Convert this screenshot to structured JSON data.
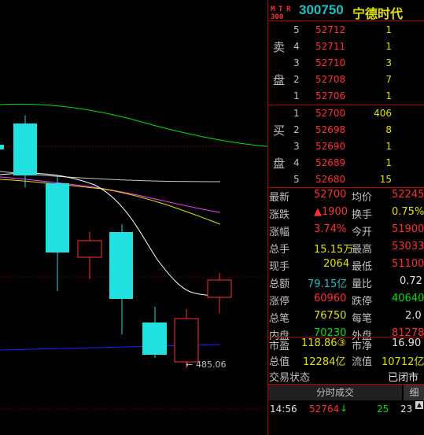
{
  "chart": {
    "low_annotation": "485.06",
    "colors": {
      "up": "#ff3030",
      "down": "#20e0e0",
      "ma5": "#ffffff",
      "ma10": "#e0e000",
      "ma20": "#ff40ff",
      "ma60": "#00e000",
      "bg": "#000000",
      "grid": "#7a0000",
      "blue": "#2020ff"
    }
  },
  "header": {
    "badge": [
      "M",
      "T",
      "R",
      "300"
    ],
    "code": "300750",
    "name": "宁德时代"
  },
  "orderbook": {
    "sell_label_1": "卖",
    "sell_label_2": "盘",
    "buy_label_1": "买",
    "buy_label_2": "盘",
    "sell": [
      {
        "level": "5",
        "price": "52712",
        "vol": "1"
      },
      {
        "level": "4",
        "price": "52711",
        "vol": "1"
      },
      {
        "level": "3",
        "price": "52710",
        "vol": "3"
      },
      {
        "level": "2",
        "price": "52708",
        "vol": "7"
      },
      {
        "level": "1",
        "price": "52706",
        "vol": "1"
      }
    ],
    "buy": [
      {
        "level": "1",
        "price": "52700",
        "vol": "406"
      },
      {
        "level": "2",
        "price": "52698",
        "vol": "8"
      },
      {
        "level": "3",
        "price": "52690",
        "vol": "1"
      },
      {
        "level": "4",
        "price": "52689",
        "vol": "1"
      },
      {
        "level": "5",
        "price": "52680",
        "vol": "15"
      }
    ]
  },
  "quote": {
    "latest_label": "最新",
    "latest": "52700",
    "avg_label": "均价",
    "avg": "52245",
    "change_label": "涨跌",
    "change": "▲1900",
    "turnover_label": "换手",
    "turnover": "0.75%",
    "pct_label": "涨幅",
    "pct": "3.74%",
    "open_label": "今开",
    "open": "51900",
    "vol_label": "总手",
    "vol": "15.15万",
    "high_label": "最高",
    "high": "53033",
    "cur_label": "现手",
    "cur": "2064",
    "low_label": "最低",
    "low": "51100",
    "amount_label": "总额",
    "amount": "79.15亿",
    "ratio_label": "量比",
    "ratio": "0.72",
    "limitup_label": "涨停",
    "limitup": "60960",
    "limitdown_label": "跌停",
    "limitdown": "40640",
    "trades_label": "总笔",
    "trades": "76750",
    "pertrade_label": "每笔",
    "pertrade": "2.0",
    "inner_label": "内盘",
    "inner": "70230",
    "outer_label": "外盘",
    "outer": "81278",
    "pe_label": "市盈",
    "pe": "118.86③",
    "pb_label": "市净",
    "pb": "16.90",
    "mktcap_label": "总值",
    "mktcap": "12284亿",
    "float_label": "流值",
    "float": "10712亿",
    "status_label": "交易状态",
    "status": "已闭市"
  },
  "ticks_panel": {
    "tab1": "分时成交",
    "tab2": "细",
    "rows": [
      {
        "time": "14:56",
        "price": "52764",
        "arrow": "↓",
        "vol": "25",
        "count": "23"
      }
    ]
  }
}
